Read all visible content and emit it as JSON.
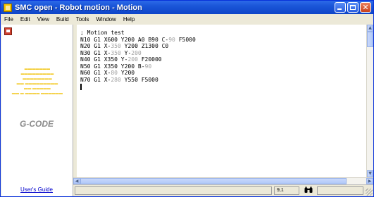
{
  "window": {
    "title": "SMC open - Robot motion - Motion",
    "controls": {
      "minimize": "minimize",
      "maximize": "maximize",
      "close": "✕"
    }
  },
  "menu": [
    "File",
    "Edit",
    "View",
    "Build",
    "Tools",
    "Window",
    "Help"
  ],
  "sidebar": {
    "logo_lines": [
      "▬▬▬▬▬▬▬",
      "▬▬▬▬▬▬▬▬▬",
      "▬▬▬▬▬▬▬▬",
      "▬▬ ▬▬▬▬▬▬▬▬▬",
      "▬▬ ▬▬▬▬▬",
      "▬▬ ▬ ▬▬▬▬ ▬▬▬▬▬▬"
    ],
    "product": "G-CODE",
    "users_guide": "User's Guide"
  },
  "editor": {
    "lines": [
      [
        {
          "t": "; Motion test"
        }
      ],
      [
        {
          "t": "N10 G1 X600 Y200 A0 B90 C-"
        },
        {
          "t": "90",
          "n": true
        },
        {
          "t": " F5000"
        }
      ],
      [
        {
          "t": "N20 G1 X-"
        },
        {
          "t": "350",
          "n": true
        },
        {
          "t": " Y200 Z1300 C0"
        }
      ],
      [
        {
          "t": "N30 G1 X-"
        },
        {
          "t": "350",
          "n": true
        },
        {
          "t": " Y-"
        },
        {
          "t": "200",
          "n": true
        }
      ],
      [
        {
          "t": "N40 G1 X350 Y-"
        },
        {
          "t": "200",
          "n": true
        },
        {
          "t": " F20000"
        }
      ],
      [
        {
          "t": "N50 G1 X350 Y200 B-"
        },
        {
          "t": "90",
          "n": true
        }
      ],
      [
        {
          "t": "N60 G1 X-"
        },
        {
          "t": "80",
          "n": true
        },
        {
          "t": " Y200"
        }
      ],
      [
        {
          "t": "N70 G1 X-"
        },
        {
          "t": "280",
          "n": true
        },
        {
          "t": " Y550 F5000"
        }
      ]
    ]
  },
  "status": {
    "position": "9,1",
    "icon": "binoculars-icon"
  },
  "colors": {
    "titlebar": "#1a55d8",
    "logo_yellow": "#f0c000",
    "link": "#0000cc",
    "number_gray": "#a0a0a0"
  }
}
